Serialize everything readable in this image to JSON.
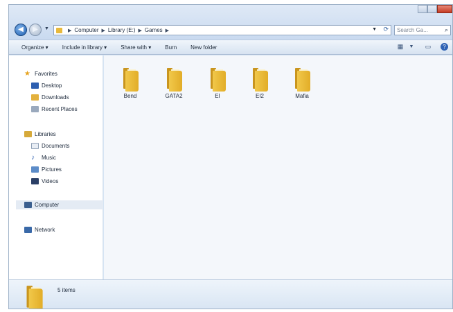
{
  "window": {
    "caption_buttons": [
      "minimize",
      "maximize",
      "close"
    ]
  },
  "nav": {
    "back_icon": "back-arrow-icon",
    "forward_icon": "forward-arrow-icon"
  },
  "address": {
    "crumbs": [
      "Computer",
      "Library (E:)",
      "Games"
    ]
  },
  "search": {
    "placeholder": "Search Ga..."
  },
  "toolbar": {
    "organize": "Organize ▾",
    "include_in_library": "Include in library ▾",
    "share_with": "Share with ▾",
    "burn": "Burn",
    "new_folder": "New folder"
  },
  "sidebar": {
    "favorites": "Favorites",
    "desktop": "Desktop",
    "downloads": "Downloads",
    "recent_places": "Recent Places",
    "libraries": "Libraries",
    "documents": "Documents",
    "music": "Music",
    "pictures": "Pictures",
    "videos": "Videos",
    "computer": "Computer",
    "network": "Network"
  },
  "files": [
    {
      "name": "Bend"
    },
    {
      "name": "GATA2"
    },
    {
      "name": "EI"
    },
    {
      "name": "EI2"
    },
    {
      "name": "Mafia"
    }
  ],
  "status": {
    "item_count": "5 items"
  },
  "colors": {
    "folder": "#e8b93c",
    "accent": "#2f63b5",
    "close": "#c53a22"
  }
}
